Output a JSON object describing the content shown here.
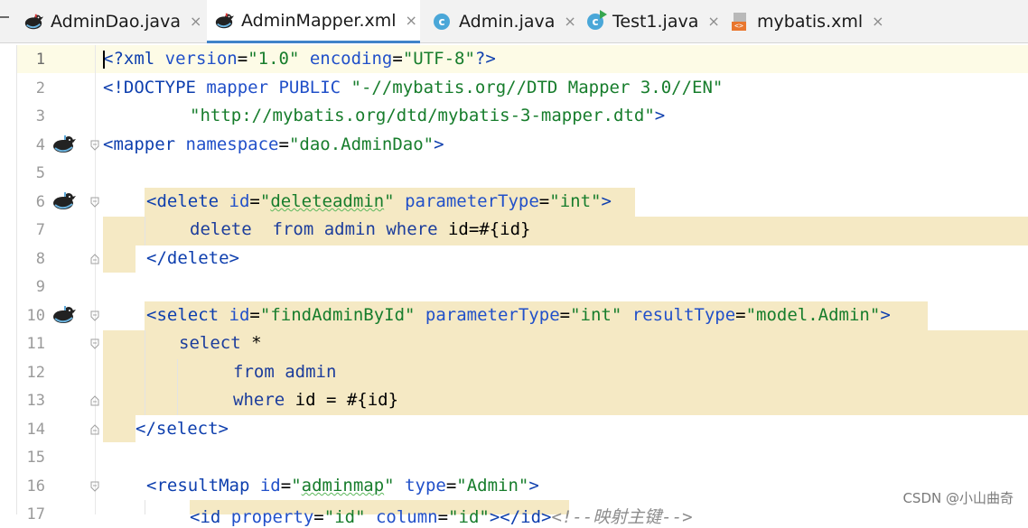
{
  "tabs": [
    {
      "label": "AdminDao.java",
      "icon": "mybatis-bird-icon",
      "active": false
    },
    {
      "label": "AdminMapper.xml",
      "icon": "mybatis-bird-icon",
      "active": true
    },
    {
      "label": "Admin.java",
      "icon": "java-class-icon",
      "icon_glyph": "c",
      "active": false
    },
    {
      "label": "Test1.java",
      "icon": "java-runnable-class-icon",
      "icon_glyph": "c",
      "active": false
    },
    {
      "label": "mybatis.xml",
      "icon": "xml-file-icon",
      "icon_glyph": "<>",
      "active": false
    }
  ],
  "close_glyph": "×",
  "editor": {
    "current_line": 1,
    "lines": [
      {
        "no": "1"
      },
      {
        "no": "2"
      },
      {
        "no": "3"
      },
      {
        "no": "4"
      },
      {
        "no": "5"
      },
      {
        "no": "6"
      },
      {
        "no": "7"
      },
      {
        "no": "8"
      },
      {
        "no": "9"
      },
      {
        "no": "10"
      },
      {
        "no": "11"
      },
      {
        "no": "12"
      },
      {
        "no": "13"
      },
      {
        "no": "14"
      },
      {
        "no": "15"
      },
      {
        "no": "16"
      },
      {
        "no": "17"
      }
    ],
    "code": {
      "l1": [
        "<?",
        "xml ",
        "version",
        "=",
        "\"1.0\"",
        " ",
        "encoding",
        "=",
        "\"UTF-8\"",
        "?>"
      ],
      "l2": [
        "<!DOCTYPE ",
        "mapper ",
        "PUBLIC ",
        "\"-//mybatis.org//DTD Mapper 3.0//EN\""
      ],
      "l3": [
        "\"http://mybatis.org/dtd/mybatis-3-mapper.dtd\"",
        ">"
      ],
      "l4": [
        "<",
        "mapper ",
        "namespace",
        "=",
        "\"dao.AdminDao\"",
        ">"
      ],
      "l6": [
        "<",
        "delete ",
        "id",
        "=",
        "\"",
        "deleteadmin",
        "\"",
        " ",
        "parameterType",
        "=",
        "\"int\"",
        ">"
      ],
      "l7": [
        "delete  from admin where ",
        "id=#{id}"
      ],
      "l8": [
        "</",
        "delete",
        ">"
      ],
      "l10": [
        "<",
        "select ",
        "id",
        "=",
        "\"findAdminById\"",
        " ",
        "parameterType",
        "=",
        "\"int\"",
        " ",
        "resultType",
        "=",
        "\"model.Admin\"",
        ">"
      ],
      "l11": [
        "select ",
        "*"
      ],
      "l12": [
        "from admin"
      ],
      "l13": [
        "where ",
        "id = #{id}"
      ],
      "l14": [
        "</",
        "select",
        ">"
      ],
      "l16": [
        "<",
        "resultMap ",
        "id",
        "=",
        "\"",
        "adminmap",
        "\"",
        " ",
        "type",
        "=",
        "\"Admin\"",
        ">"
      ],
      "l17": [
        "<",
        "id ",
        "property",
        "=",
        "\"id\"",
        " ",
        "column",
        "=",
        "\"id\"",
        "></",
        "id",
        ">",
        "<!--映射主键-->"
      ]
    }
  },
  "watermark": "CSDN @小山曲奇",
  "colors": {
    "tag": "#0e3fae",
    "attribute": "#2150c9",
    "string": "#177d2c",
    "sql_keyword": "#1c3d9c",
    "highlight": "#f5e9c4",
    "active_tab_underline": "#4083c9"
  }
}
